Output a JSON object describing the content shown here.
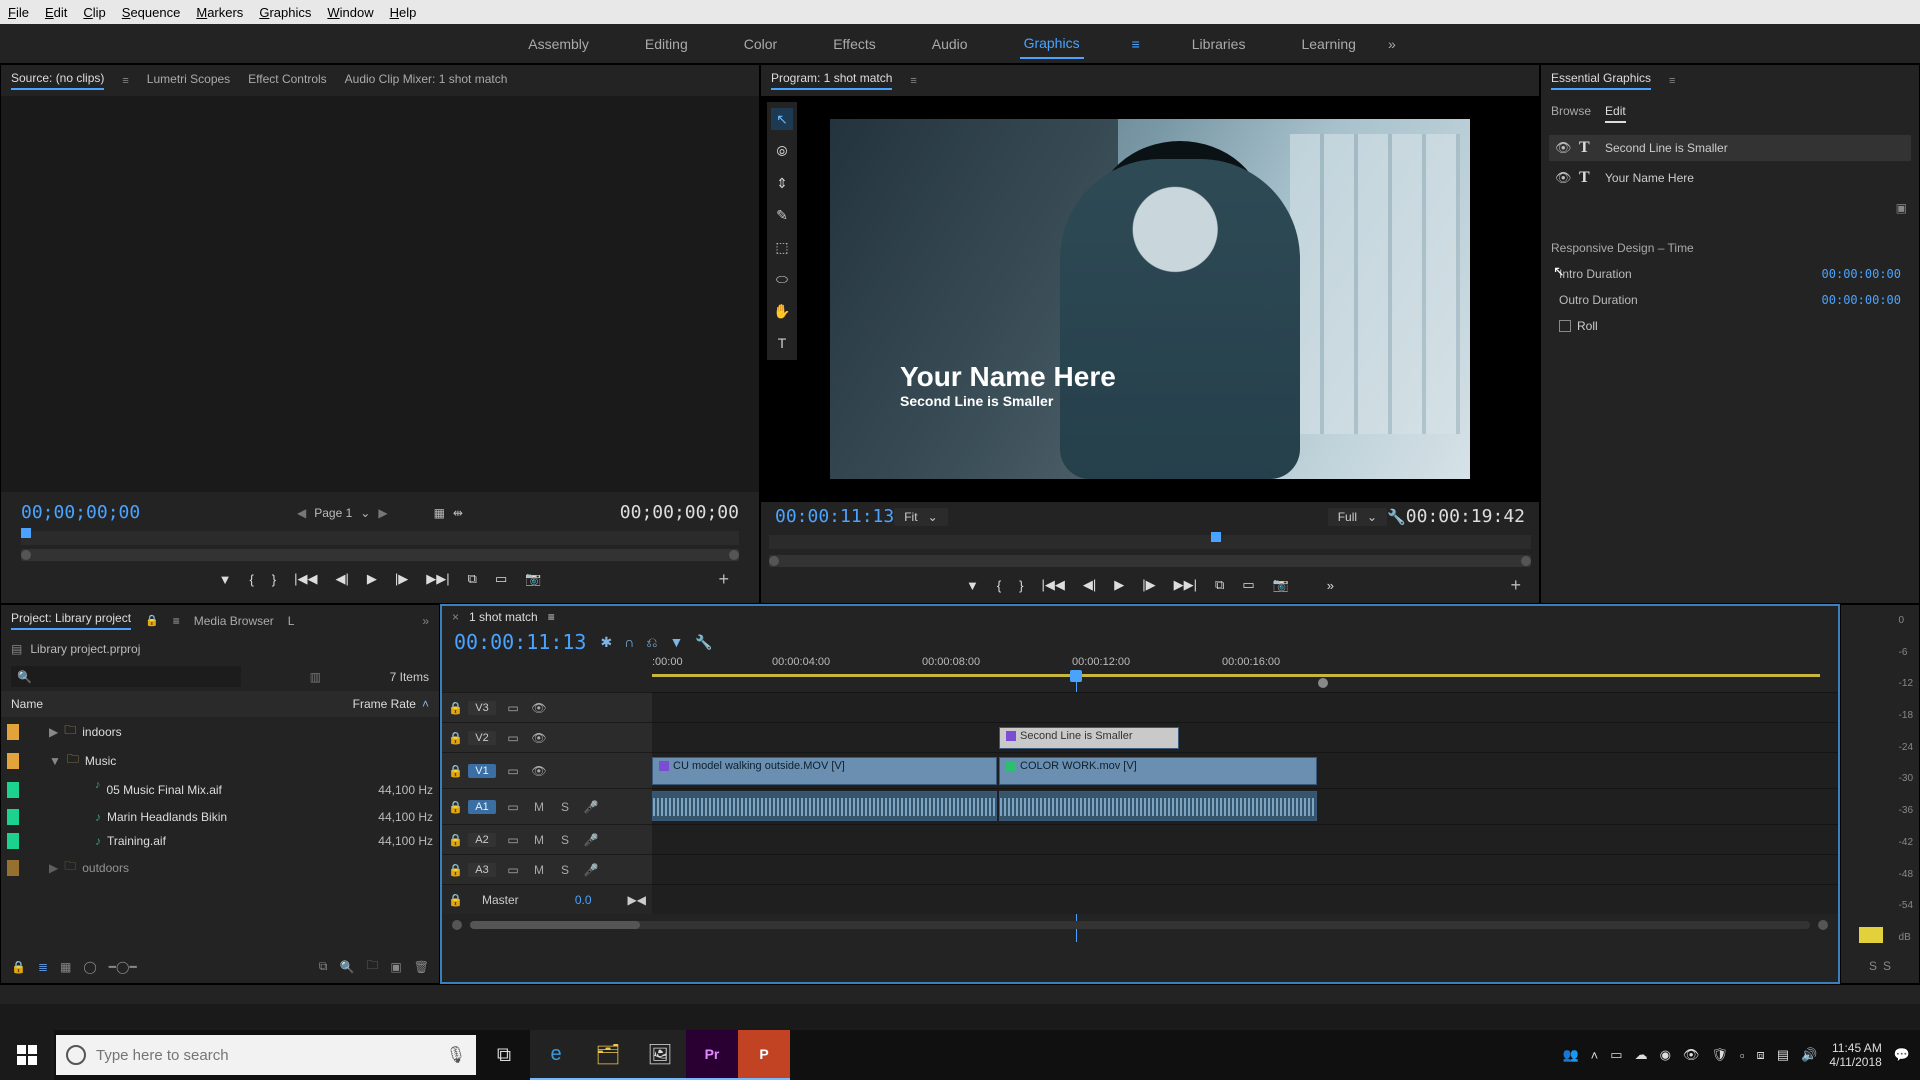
{
  "menu": {
    "file": "File",
    "edit": "Edit",
    "clip": "Clip",
    "sequence": "Sequence",
    "markers": "Markers",
    "graphics": "Graphics",
    "window": "Window",
    "help": "Help"
  },
  "workspaces": {
    "items": [
      "Assembly",
      "Editing",
      "Color",
      "Effects",
      "Audio",
      "Graphics",
      "Libraries",
      "Learning"
    ],
    "active": "Graphics"
  },
  "source": {
    "tabs": [
      "Source: (no clips)",
      "Lumetri Scopes",
      "Effect Controls",
      "Audio Clip Mixer: 1 shot match"
    ],
    "active": "Source: (no clips)",
    "tc_left": "00;00;00;00",
    "page": "Page 1",
    "tc_right": "00;00;00;00"
  },
  "program": {
    "tab": "Program: 1 shot match",
    "tc_left": "00:00:11:13",
    "fit": "Fit",
    "full": "Full",
    "tc_right": "00:00:19:42",
    "overlay_line1": "Your Name Here",
    "overlay_line2": "Second Line is Smaller"
  },
  "eg": {
    "title": "Essential Graphics",
    "tabs": [
      "Browse",
      "Edit"
    ],
    "active": "Edit",
    "layers": [
      {
        "name": "Second Line is Smaller"
      },
      {
        "name": "Your Name Here"
      }
    ],
    "section": "Responsive Design – Time",
    "intro_label": "Intro Duration",
    "intro_val": "00:00:00:00",
    "outro_label": "Outro Duration",
    "outro_val": "00:00:00:00",
    "roll": "Roll"
  },
  "project": {
    "tabs": [
      "Project: Library project",
      "Media Browser",
      "L"
    ],
    "active": "Project: Library project",
    "filename": "Library project.prproj",
    "count": "7 Items",
    "col_name": "Name",
    "col_rate": "Frame Rate",
    "rows": [
      {
        "type": "bin",
        "indent": 1,
        "label": "indoors",
        "rate": "",
        "swatch": "color-orange",
        "exp": "▶"
      },
      {
        "type": "bin",
        "indent": 1,
        "label": "Music",
        "rate": "",
        "swatch": "color-orange",
        "exp": "▼"
      },
      {
        "type": "clip",
        "indent": 3,
        "label": "05 Music Final Mix.aif",
        "rate": "44,100 Hz",
        "swatch": "color-green"
      },
      {
        "type": "clip",
        "indent": 3,
        "label": "Marin Headlands Bikin",
        "rate": "44,100 Hz",
        "swatch": "color-green"
      },
      {
        "type": "clip",
        "indent": 3,
        "label": "Training.aif",
        "rate": "44,100 Hz",
        "swatch": "color-green"
      },
      {
        "type": "bin",
        "indent": 1,
        "label": "outdoors",
        "rate": "",
        "swatch": "color-orange",
        "exp": "▶"
      }
    ]
  },
  "timeline": {
    "seq": "1 shot match",
    "tc": "00:00:11:13",
    "ruler": [
      ":00:00",
      "00:00:04:00",
      "00:00:08:00",
      "00:00:12:00",
      "00:00:16:00"
    ],
    "tracks": {
      "v3": "V3",
      "v2": "V2",
      "v1": "V1",
      "a1": "A1",
      "a2": "A2",
      "a3": "A3",
      "master": "Master",
      "master_val": "0.0"
    },
    "clips": {
      "gfx": "Second Line is Smaller",
      "v_left": "CU model walking outside.MOV [V]",
      "v_right": "COLOR WORK.mov [V]"
    }
  },
  "meters": {
    "labels": [
      "0",
      "-6",
      "-12",
      "-18",
      "-24",
      "-30",
      "-36",
      "-42",
      "-48",
      "-54",
      "dB"
    ],
    "s": "S"
  },
  "taskbar": {
    "search_placeholder": "Type here to search",
    "time": "11:45 AM",
    "date": "4/11/2018"
  }
}
